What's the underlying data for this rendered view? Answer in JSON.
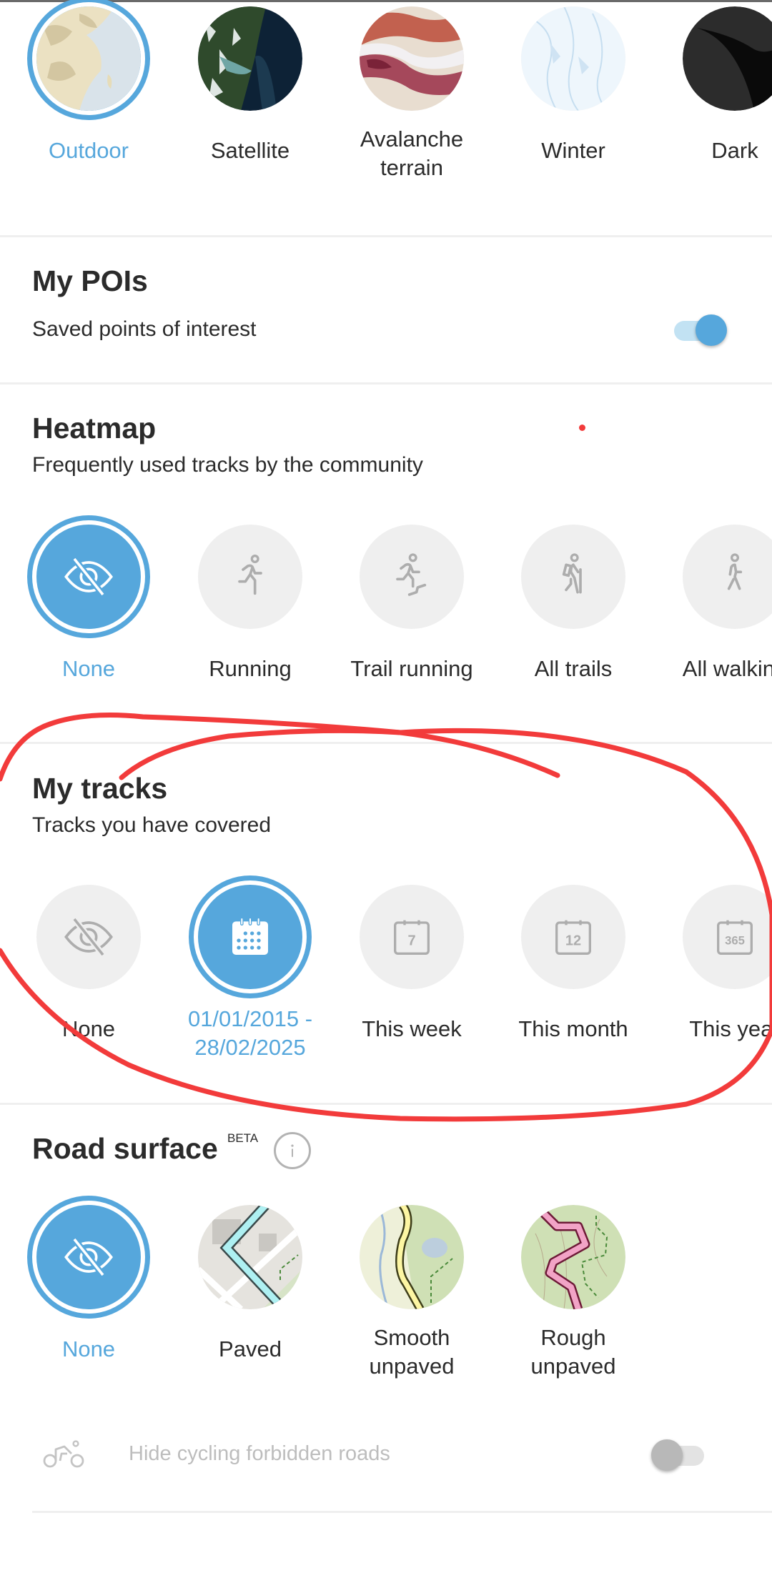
{
  "map_styles": {
    "selected": "Outdoor",
    "items": [
      {
        "label": "Outdoor",
        "icon": "outdoor-map-thumbnail",
        "selected": true
      },
      {
        "label": "Satellite",
        "icon": "satellite-map-thumbnail",
        "selected": false
      },
      {
        "label": "Avalanche terrain",
        "icon": "avalanche-map-thumbnail",
        "selected": false
      },
      {
        "label": "Winter",
        "icon": "winter-map-thumbnail",
        "selected": false
      },
      {
        "label": "Dark",
        "icon": "dark-map-thumbnail",
        "selected": false
      }
    ]
  },
  "my_pois": {
    "title": "My POIs",
    "subtitle": "Saved points of interest",
    "toggle_on": true
  },
  "heatmap": {
    "title": "Heatmap",
    "subtitle": "Frequently used tracks by the community",
    "selected": "None",
    "items": [
      {
        "label": "None",
        "icon": "eye-off-icon",
        "selected": true
      },
      {
        "label": "Running",
        "icon": "running-icon",
        "selected": false
      },
      {
        "label": "Trail running",
        "icon": "trail-running-icon",
        "selected": false
      },
      {
        "label": "All trails",
        "icon": "hiking-icon",
        "selected": false
      },
      {
        "label": "All walking",
        "icon": "walking-icon",
        "selected": false
      }
    ]
  },
  "my_tracks": {
    "title": "My tracks",
    "subtitle": "Tracks you have covered",
    "selected": "01/01/2015 - 28/02/2025",
    "items": [
      {
        "label": "None",
        "icon": "eye-off-icon",
        "selected": false
      },
      {
        "label_line1": "01/01/2015 -",
        "label_line2": "28/02/2025",
        "icon": "calendar-icon",
        "selected": true
      },
      {
        "label": "This week",
        "icon": "calendar-7-icon",
        "badge": "7",
        "selected": false
      },
      {
        "label": "This month",
        "icon": "calendar-12-icon",
        "badge": "12",
        "selected": false
      },
      {
        "label": "This year",
        "icon": "calendar-365-icon",
        "badge": "365",
        "selected": false
      }
    ]
  },
  "road_surface": {
    "title": "Road surface",
    "badge": "BETA",
    "selected": "None",
    "items": [
      {
        "label": "None",
        "icon": "eye-off-icon",
        "selected": true
      },
      {
        "label": "Paved",
        "icon": "paved-map-thumbnail",
        "selected": false
      },
      {
        "label_line1": "Smooth",
        "label_line2": "unpaved",
        "icon": "smooth-unpaved-map-thumbnail",
        "selected": false
      },
      {
        "label_line1": "Rough",
        "label_line2": "unpaved",
        "icon": "rough-unpaved-map-thumbnail",
        "selected": false
      }
    ]
  },
  "cycling": {
    "label": "Hide cycling forbidden roads",
    "toggle_on": false
  },
  "colors": {
    "accent": "#56a7dc",
    "annotation": "#f23b3b",
    "text": "#2b2b2b",
    "disabled_text": "#bdbdbd"
  }
}
